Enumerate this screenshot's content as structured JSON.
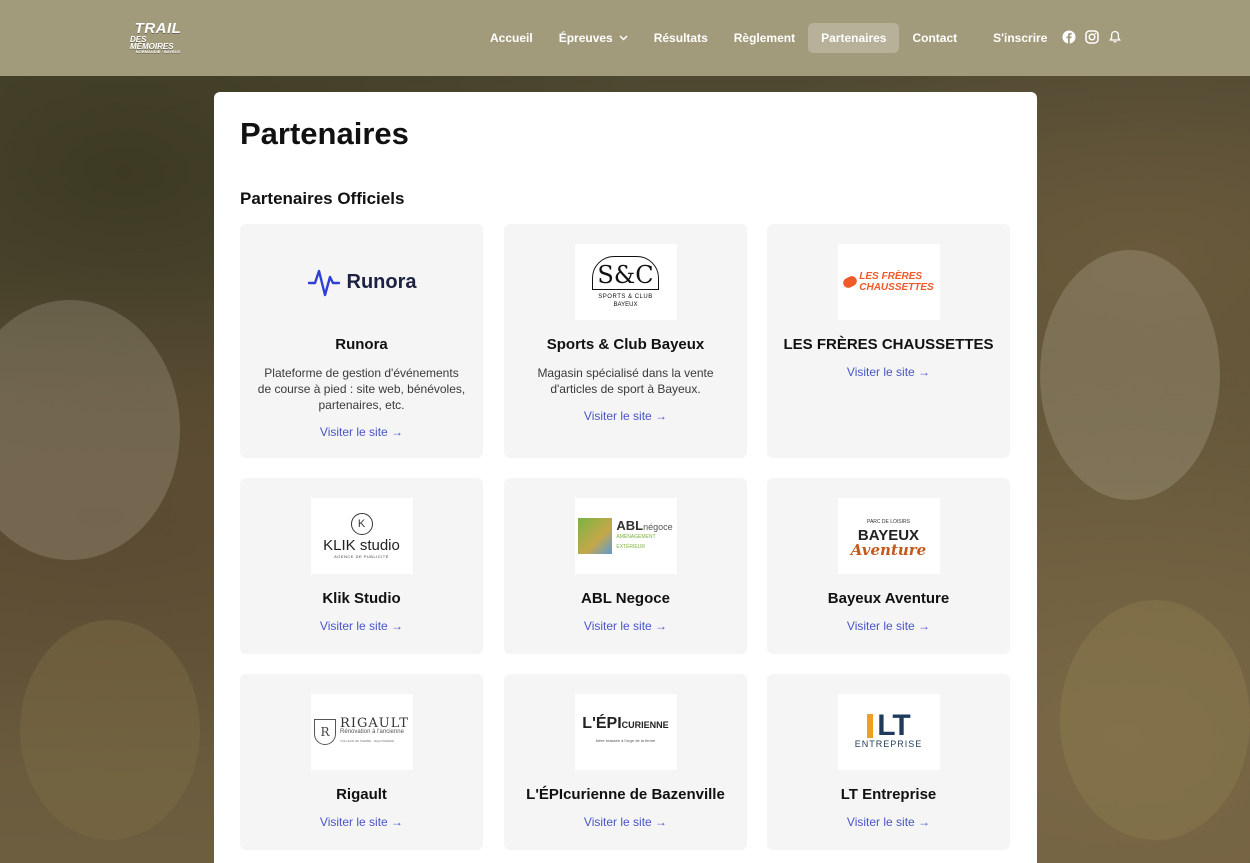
{
  "header": {
    "logo": {
      "line1": "TRAIL",
      "line2": "DES MÉMOIRES",
      "line3": "NORMANDIE · BAYEUX"
    },
    "nav": [
      {
        "label": "Accueil",
        "active": false
      },
      {
        "label": "Épreuves",
        "active": false,
        "has_dropdown": true
      },
      {
        "label": "Résultats",
        "active": false
      },
      {
        "label": "Règlement",
        "active": false
      },
      {
        "label": "Partenaires",
        "active": true
      },
      {
        "label": "Contact",
        "active": false
      }
    ],
    "cta_label": "S'inscrire",
    "social_icons": [
      "facebook-icon",
      "instagram-icon",
      "bell-icon"
    ]
  },
  "page": {
    "title": "Partenaires",
    "section_title": "Partenaires Officiels"
  },
  "partners": [
    {
      "name": "Runora",
      "description": "Plateforme de gestion d'événements de course à pied : site web, bénévoles, partenaires, etc.",
      "link": "Visiter le site →",
      "logo_text": "Runora"
    },
    {
      "name": "Sports & Club Bayeux",
      "description": "Magasin spécialisé dans la vente d'articles de sport à Bayeux.",
      "link": "Visiter le site →",
      "logo_text": "S&C",
      "logo_sub": "SPORTS & CLUB",
      "logo_sub2": "BAYEUX"
    },
    {
      "name": "LES FRÈRES CHAUSSETTES",
      "description": "",
      "link": "Visiter le site →",
      "logo_text": "LES FRÈRES",
      "logo_sub": "CHAUSSETTES"
    },
    {
      "name": "Klik Studio",
      "description": "",
      "link": "Visiter le site →",
      "logo_text": "KLIK studio",
      "logo_sub": "AGENCE DE PUBLICITÉ"
    },
    {
      "name": "ABL Negoce",
      "description": "",
      "link": "Visiter le site →",
      "logo_text": "ABL",
      "logo_sub": "négoce",
      "logo_sub2": "AMÉNAGEMENT EXTÉRIEUR"
    },
    {
      "name": "Bayeux Aventure",
      "description": "",
      "link": "Visiter le site →",
      "logo_text": "BAYEUX",
      "logo_sub": "Aventure",
      "logo_sub2": "PARC DE LOISIRS"
    },
    {
      "name": "Rigault",
      "description": "",
      "link": "Visiter le site →",
      "logo_text": "RIGAULT",
      "logo_sub": "Rénovation à l'ancienne",
      "logo_sub2": "TAILLEUR DE PIERRE · MAÇONNERIE"
    },
    {
      "name": "L'ÉPIcurienne de Bazenville",
      "description": "",
      "link": "Visiter le site →",
      "logo_text": "L'ÉPI",
      "logo_sub": "CURIENNE",
      "logo_sub2": "bière brassée à l'orge de la ferme"
    },
    {
      "name": "LT Entreprise",
      "description": "",
      "link": "Visiter le site →",
      "logo_text": "LT",
      "logo_sub": "ENTREPRISE"
    }
  ],
  "colors": {
    "header_bg": "#a29b7b",
    "link": "#4a55c8",
    "card_bg": "#f5f5f6",
    "runora_blue": "#2f3fd6",
    "chaussettes_orange": "#f05a28",
    "bayeux_brown": "#c05a1c"
  }
}
